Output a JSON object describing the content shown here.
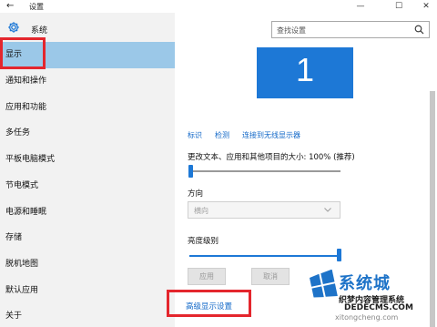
{
  "window": {
    "title": "设置",
    "back_glyph": "←",
    "minimize_glyph": "—",
    "maximize_glyph": "☐",
    "close_glyph": "✕"
  },
  "sidebar": {
    "title": "系统",
    "items": [
      {
        "label": "显示",
        "selected": true
      },
      {
        "label": "通知和操作"
      },
      {
        "label": "应用和功能"
      },
      {
        "label": "多任务"
      },
      {
        "label": "平板电脑模式"
      },
      {
        "label": "节电模式"
      },
      {
        "label": "电源和睡眠"
      },
      {
        "label": "存储"
      },
      {
        "label": "脱机地图"
      },
      {
        "label": "默认应用"
      },
      {
        "label": "关于"
      }
    ]
  },
  "search": {
    "placeholder": "查找设置"
  },
  "display": {
    "monitor_number": "1",
    "links": [
      "标识",
      "检测",
      "连接到无线显示器"
    ],
    "scale_label": "更改文本、应用和其他项目的大小: 100% (推荐)",
    "scale_level": 0,
    "orientation_label": "方向",
    "orientation_value": "横向",
    "brightness_label": "亮度级别",
    "brightness_level": 1.0,
    "apply_button": "应用",
    "cancel_button": "取消",
    "advanced_link": "高级显示设置"
  },
  "watermark": {
    "brand": "系统城",
    "brand_sub": "织梦内容管理系统",
    "domain": "DEDECMS.COM",
    "url": "xitongcheng.com"
  },
  "colors": {
    "accent": "#1d78d6",
    "selected_bg": "#9bc8e8",
    "highlight_box": "#e4262d",
    "sidebar_bg": "#f2f2f2"
  }
}
